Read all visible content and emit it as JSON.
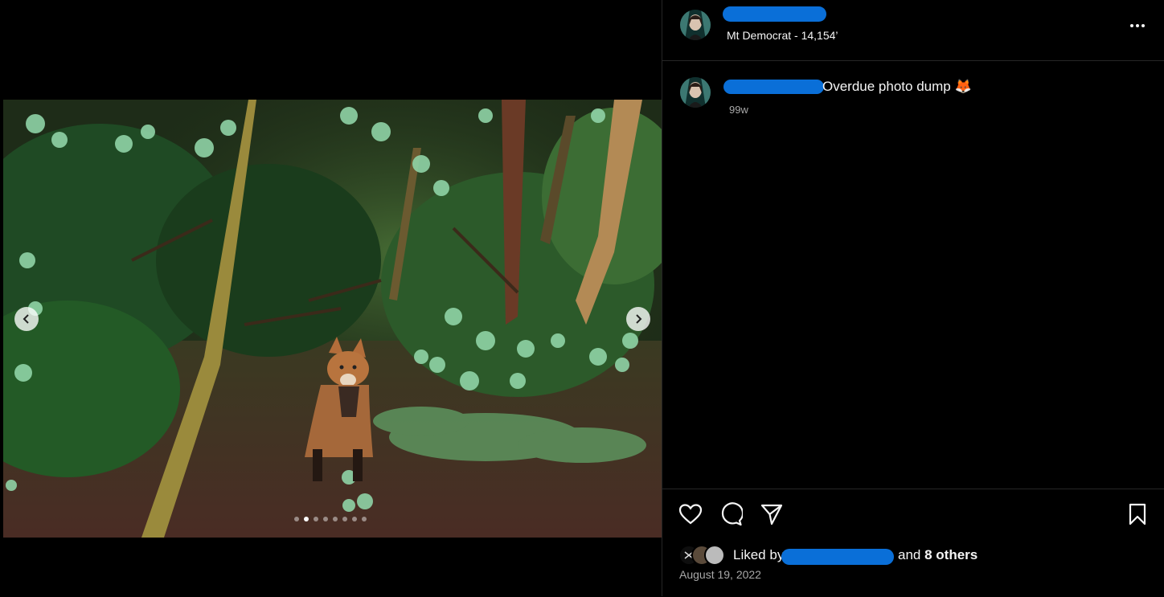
{
  "post": {
    "location": "Mt Democrat - 14,154’",
    "caption": "Overdue photo dump",
    "caption_emoji": "🦊",
    "age": "99w",
    "liked_by_prefix": "Liked by",
    "liked_by_and": "and",
    "liked_by_others": "8 others",
    "date": "August 19, 2022"
  },
  "carousel": {
    "total_slides": 8,
    "active_slide": 2
  },
  "icons": {
    "more": "more-horizontal-icon",
    "like": "heart-icon",
    "comment": "comment-icon",
    "share": "send-icon",
    "save": "bookmark-icon",
    "prev": "chevron-left-icon",
    "next": "chevron-right-icon"
  },
  "colors": {
    "redaction": "#0a6fd8",
    "background": "#000000",
    "divider": "#262626",
    "secondary_text": "#a8a8a8"
  }
}
